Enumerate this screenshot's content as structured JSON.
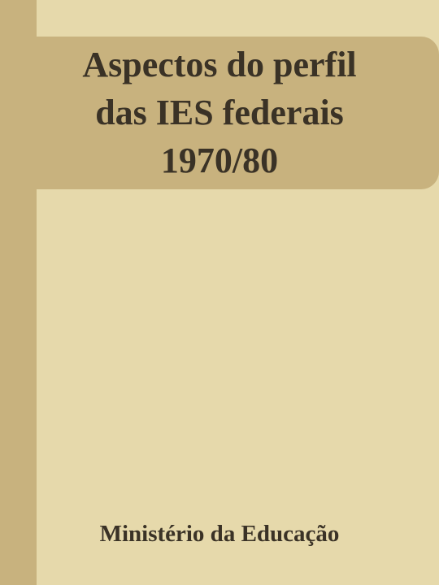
{
  "cover": {
    "title_lines": [
      "Aspectos do perfil",
      "das IES federais",
      "1970/80"
    ],
    "author": "Ministério da Educação"
  },
  "colors": {
    "background": "#e6d9ab",
    "band": "#c8b27e",
    "text": "#3a3226"
  }
}
